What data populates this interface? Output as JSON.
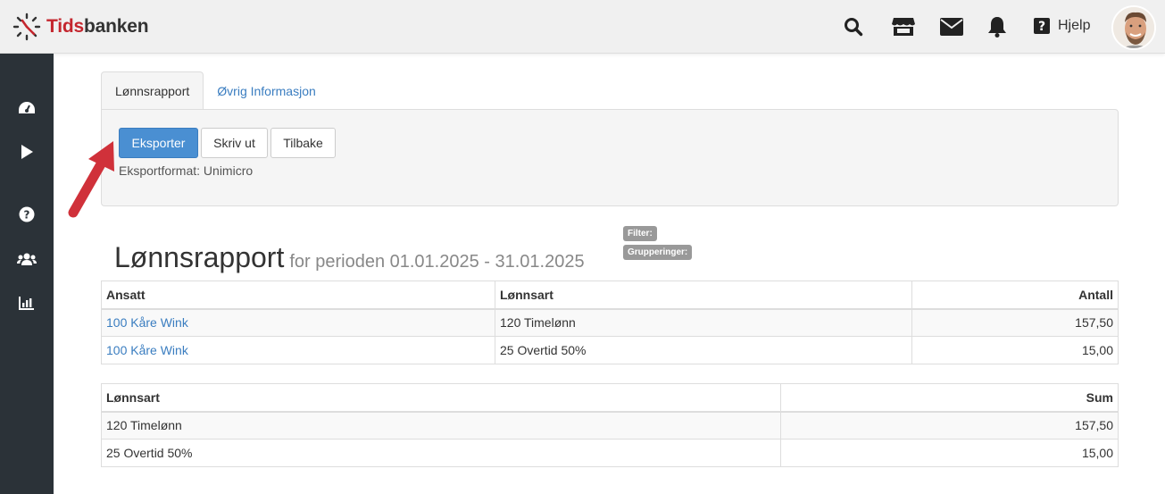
{
  "app": {
    "brand_part1": "Tids",
    "brand_part2": "banken",
    "help_label": "Hjelp"
  },
  "icons": {
    "top": [
      "search-icon",
      "store-icon",
      "mail-icon",
      "bell-icon",
      "help-icon"
    ],
    "sidebar": [
      "dashboard-icon",
      "play-icon",
      "question-icon",
      "users-icon",
      "chart-icon"
    ]
  },
  "tabs": [
    {
      "label": "Lønnsrapport",
      "active": true
    },
    {
      "label": "Øvrig Informasjon",
      "active": false
    }
  ],
  "toolbar": {
    "export_label": "Eksporter",
    "print_label": "Skriv ut",
    "back_label": "Tilbake",
    "export_format": "Eksportformat: Unimicro"
  },
  "badges": {
    "filter": "Filter:",
    "groupings": "Grupperinger:"
  },
  "report": {
    "title": "Lønnsrapport",
    "period": "for perioden 01.01.2025 - 31.01.2025"
  },
  "table1": {
    "headers": [
      "Ansatt",
      "Lønnsart",
      "Antall"
    ],
    "rows": [
      [
        "100 Kåre Wink",
        "120 Timelønn",
        "157,50"
      ],
      [
        "100 Kåre Wink",
        "25 Overtid 50%",
        "15,00"
      ]
    ]
  },
  "table2": {
    "headers": [
      "Lønnsart",
      "Sum"
    ],
    "rows": [
      [
        "120 Timelønn",
        "157,50"
      ],
      [
        "25 Overtid 50%",
        "15,00"
      ]
    ]
  },
  "colors": {
    "brand_red": "#c4262e",
    "primary_blue": "#4a8fd2",
    "link_blue": "#3a7dc0",
    "sidebar_bg": "#2b3238",
    "arrow_red": "#d0313a"
  }
}
